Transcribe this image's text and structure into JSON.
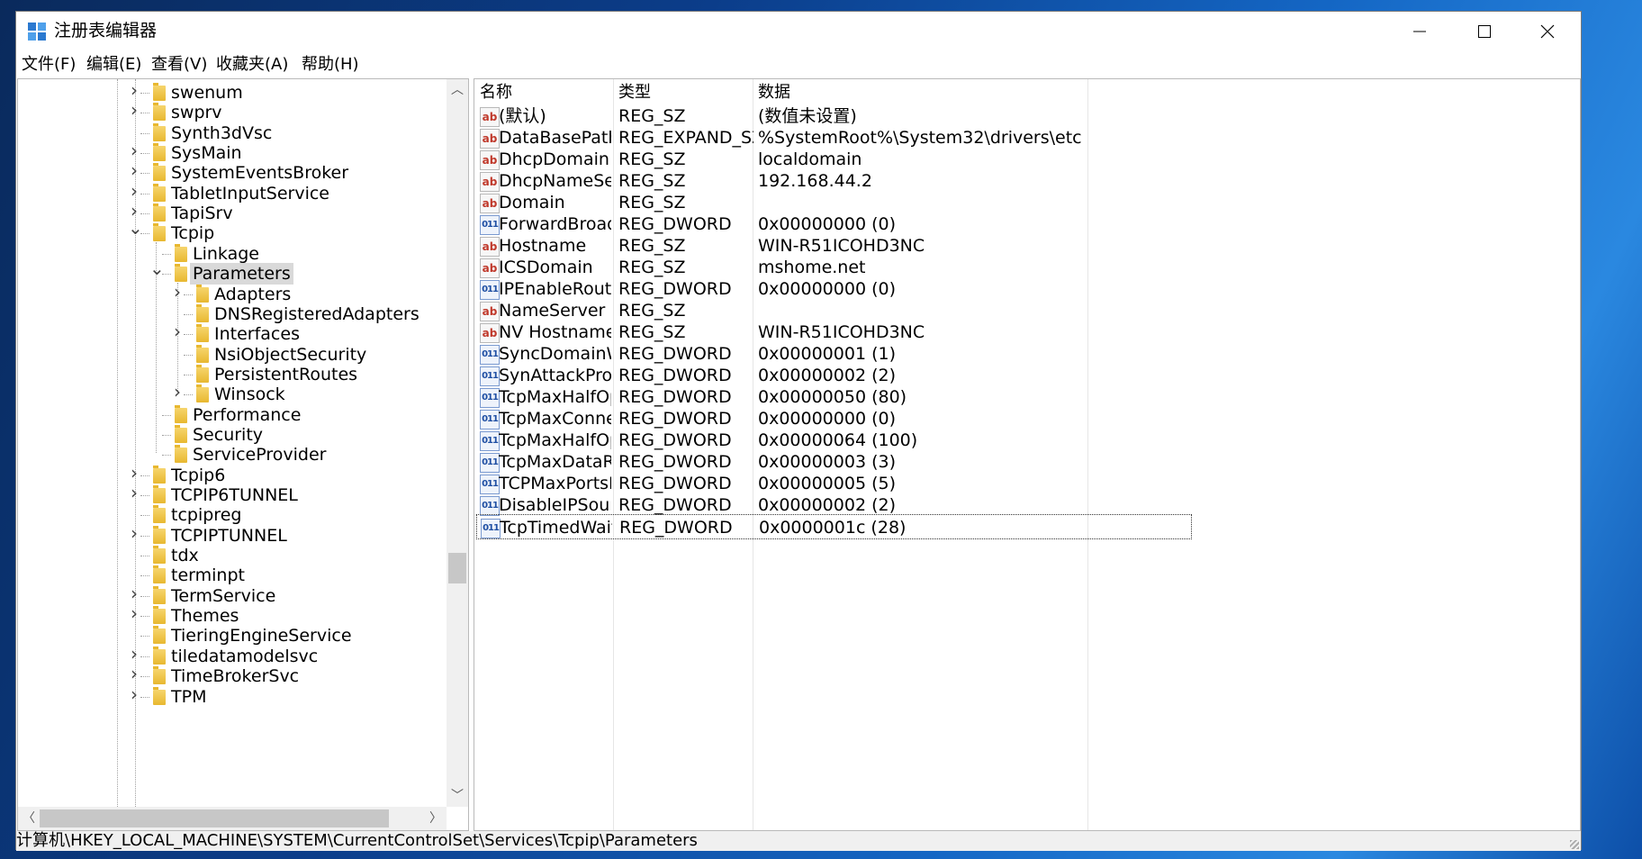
{
  "window": {
    "title": "注册表编辑器",
    "controls": {
      "minimize": "—",
      "maximize": "☐",
      "close": "✕"
    }
  },
  "menu": [
    "文件(F)",
    "编辑(E)",
    "查看(V)",
    "收藏夹(A)",
    "帮助(H)"
  ],
  "tree": {
    "items": [
      {
        "label": "swenum",
        "level": 0,
        "expander": "collapsed"
      },
      {
        "label": "swprv",
        "level": 0,
        "expander": "collapsed"
      },
      {
        "label": "Synth3dVsc",
        "level": 0,
        "expander": "none"
      },
      {
        "label": "SysMain",
        "level": 0,
        "expander": "collapsed"
      },
      {
        "label": "SystemEventsBroker",
        "level": 0,
        "expander": "collapsed"
      },
      {
        "label": "TabletInputService",
        "level": 0,
        "expander": "collapsed"
      },
      {
        "label": "TapiSrv",
        "level": 0,
        "expander": "collapsed"
      },
      {
        "label": "Tcpip",
        "level": 0,
        "expander": "expanded"
      },
      {
        "label": "Linkage",
        "level": 1,
        "expander": "none"
      },
      {
        "label": "Parameters",
        "level": 1,
        "expander": "expanded",
        "selected": true
      },
      {
        "label": "Adapters",
        "level": 2,
        "expander": "collapsed"
      },
      {
        "label": "DNSRegisteredAdapters",
        "level": 2,
        "expander": "none"
      },
      {
        "label": "Interfaces",
        "level": 2,
        "expander": "collapsed"
      },
      {
        "label": "NsiObjectSecurity",
        "level": 2,
        "expander": "none"
      },
      {
        "label": "PersistentRoutes",
        "level": 2,
        "expander": "none"
      },
      {
        "label": "Winsock",
        "level": 2,
        "expander": "collapsed"
      },
      {
        "label": "Performance",
        "level": 1,
        "expander": "none"
      },
      {
        "label": "Security",
        "level": 1,
        "expander": "none"
      },
      {
        "label": "ServiceProvider",
        "level": 1,
        "expander": "none"
      },
      {
        "label": "Tcpip6",
        "level": 0,
        "expander": "collapsed"
      },
      {
        "label": "TCPIP6TUNNEL",
        "level": 0,
        "expander": "collapsed"
      },
      {
        "label": "tcpipreg",
        "level": 0,
        "expander": "none"
      },
      {
        "label": "TCPIPTUNNEL",
        "level": 0,
        "expander": "collapsed"
      },
      {
        "label": "tdx",
        "level": 0,
        "expander": "none"
      },
      {
        "label": "terminpt",
        "level": 0,
        "expander": "none"
      },
      {
        "label": "TermService",
        "level": 0,
        "expander": "collapsed"
      },
      {
        "label": "Themes",
        "level": 0,
        "expander": "collapsed"
      },
      {
        "label": "TieringEngineService",
        "level": 0,
        "expander": "none"
      },
      {
        "label": "tiledatamodelsvc",
        "level": 0,
        "expander": "collapsed"
      },
      {
        "label": "TimeBrokerSvc",
        "level": 0,
        "expander": "collapsed"
      },
      {
        "label": "TPM",
        "level": 0,
        "expander": "collapsed"
      }
    ]
  },
  "list": {
    "columns": [
      "名称",
      "类型",
      "数据"
    ],
    "rows": [
      {
        "icon": "sz",
        "name": "(默认)",
        "type": "REG_SZ",
        "data": "(数值未设置)"
      },
      {
        "icon": "sz",
        "name": "DataBasePath",
        "type": "REG_EXPAND_SZ",
        "data": "%SystemRoot%\\System32\\drivers\\etc"
      },
      {
        "icon": "sz",
        "name": "DhcpDomain",
        "type": "REG_SZ",
        "data": "localdomain"
      },
      {
        "icon": "sz",
        "name": "DhcpNameServ...",
        "type": "REG_SZ",
        "data": "192.168.44.2"
      },
      {
        "icon": "sz",
        "name": "Domain",
        "type": "REG_SZ",
        "data": ""
      },
      {
        "icon": "dw",
        "name": "ForwardBroadc...",
        "type": "REG_DWORD",
        "data": "0x00000000 (0)"
      },
      {
        "icon": "sz",
        "name": "Hostname",
        "type": "REG_SZ",
        "data": "WIN-R51ICOHD3NC"
      },
      {
        "icon": "sz",
        "name": "ICSDomain",
        "type": "REG_SZ",
        "data": "mshome.net"
      },
      {
        "icon": "dw",
        "name": "IPEnableRouter",
        "type": "REG_DWORD",
        "data": "0x00000000 (0)"
      },
      {
        "icon": "sz",
        "name": "NameServer",
        "type": "REG_SZ",
        "data": ""
      },
      {
        "icon": "sz",
        "name": "NV Hostname",
        "type": "REG_SZ",
        "data": "WIN-R51ICOHD3NC"
      },
      {
        "icon": "dw",
        "name": "SyncDomainWi...",
        "type": "REG_DWORD",
        "data": "0x00000001 (1)"
      },
      {
        "icon": "dw",
        "name": "SynAttackProte...",
        "type": "REG_DWORD",
        "data": "0x00000002 (2)"
      },
      {
        "icon": "dw",
        "name": "TcpMaxHalfOp...",
        "type": "REG_DWORD",
        "data": "0x00000050 (80)"
      },
      {
        "icon": "dw",
        "name": "TcpMaxConnec...",
        "type": "REG_DWORD",
        "data": "0x00000000 (0)"
      },
      {
        "icon": "dw",
        "name": "TcpMaxHalfOp...",
        "type": "REG_DWORD",
        "data": "0x00000064 (100)"
      },
      {
        "icon": "dw",
        "name": "TcpMaxDataRe...",
        "type": "REG_DWORD",
        "data": "0x00000003 (3)"
      },
      {
        "icon": "dw",
        "name": "TCPMaxPortsEx...",
        "type": "REG_DWORD",
        "data": "0x00000005 (5)"
      },
      {
        "icon": "dw",
        "name": "DisableIPSourc...",
        "type": "REG_DWORD",
        "data": "0x00000002 (2)"
      },
      {
        "icon": "dw",
        "name": "TcpTimedWait...",
        "type": "REG_DWORD",
        "data": "0x0000001c (28)",
        "focused": true
      }
    ],
    "icon_glyphs": {
      "sz": "ab",
      "dw": "011"
    }
  },
  "status": {
    "path": "计算机\\HKEY_LOCAL_MACHINE\\SYSTEM\\CurrentControlSet\\Services\\Tcpip\\Parameters"
  },
  "colors": {
    "accent_string_icon": "#c0392b",
    "accent_dword_icon": "#1f4fa3",
    "selection": "#d9d9d9"
  }
}
